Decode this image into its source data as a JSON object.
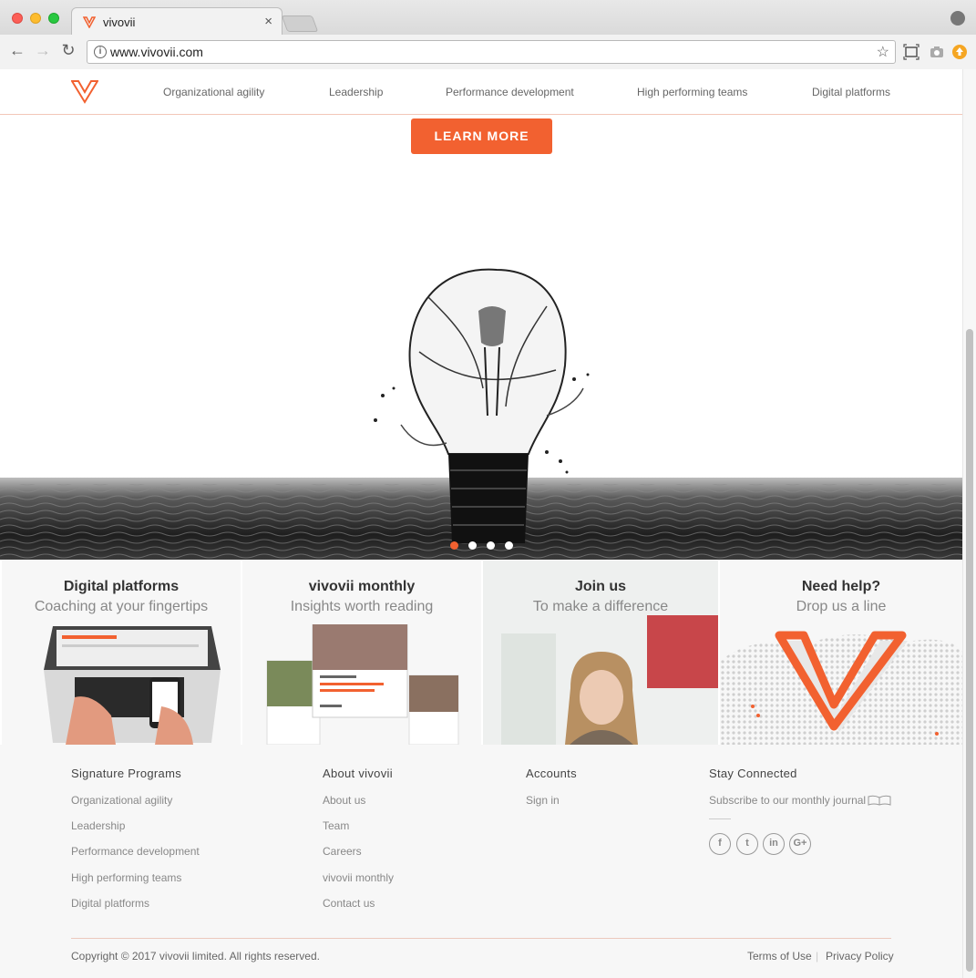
{
  "browser": {
    "tab_title": "vivovii",
    "tab_close": "×",
    "url": "www.vivovii.com",
    "back": "←",
    "forward": "→",
    "reload": "↻",
    "star": "☆"
  },
  "brand": {
    "accent": "#f26130",
    "logo": "vivovii-v-logo"
  },
  "nav": [
    "Organizational agility",
    "Leadership",
    "Performance development",
    "High performing teams",
    "Digital platforms"
  ],
  "hero": {
    "cta": "LEARN MORE",
    "slides_total": 4,
    "active_slide": 1
  },
  "tiles": [
    {
      "title": "Digital platforms",
      "subtitle": "Coaching at your fingertips"
    },
    {
      "title": "vivovii monthly",
      "subtitle": "Insights worth reading"
    },
    {
      "title": "Join us",
      "subtitle": "To make a difference"
    },
    {
      "title": "Need help?",
      "subtitle": "Drop us a line"
    }
  ],
  "footer": {
    "signature": {
      "heading": "Signature Programs",
      "links": [
        "Organizational agility",
        "Leadership",
        "Performance development",
        "High performing teams",
        "Digital platforms"
      ]
    },
    "about": {
      "heading": "About vivovii",
      "links": [
        "About us",
        "Team",
        "Careers",
        "vivovii monthly",
        "Contact us"
      ]
    },
    "accounts": {
      "heading": "Accounts",
      "links": [
        "Sign in"
      ]
    },
    "connected": {
      "heading": "Stay Connected",
      "subscribe": "Subscribe to our monthly journal",
      "social": [
        "f",
        "t",
        "in",
        "G+"
      ]
    },
    "copyright": "Copyright © 2017 vivovii limited. All rights reserved.",
    "terms": "Terms of Use",
    "privacy": "Privacy Policy",
    "legal_sep": "|"
  }
}
